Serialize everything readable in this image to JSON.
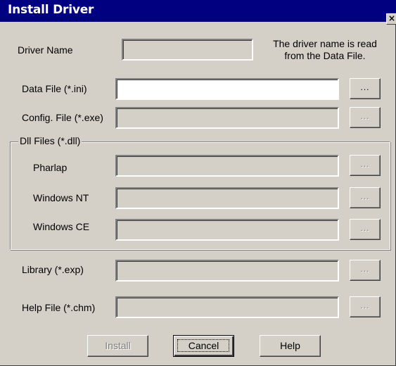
{
  "window": {
    "title": "Install Driver",
    "close_glyph": "×"
  },
  "driver_name": {
    "label": "Driver Name",
    "value": "",
    "note_line1": "The driver name is read",
    "note_line2": "from the Data File."
  },
  "data_file": {
    "label": "Data File (*.ini)",
    "value": "",
    "browse_label": "..."
  },
  "config_file": {
    "label": "Config. File (*.exe)",
    "value": "",
    "browse_label": "..."
  },
  "dll_group": {
    "title": "Dll Files (*.dll)",
    "pharlap": {
      "label": "Pharlap",
      "value": "",
      "browse_label": "..."
    },
    "windows_nt": {
      "label": "Windows NT",
      "value": "",
      "browse_label": "..."
    },
    "windows_ce": {
      "label": "Windows CE",
      "value": "",
      "browse_label": "..."
    }
  },
  "library": {
    "label": "Library (*.exp)",
    "value": "",
    "browse_label": "..."
  },
  "help_file": {
    "label": "Help File (*.chm)",
    "value": "",
    "browse_label": "..."
  },
  "buttons": {
    "install": "Install",
    "cancel": "Cancel",
    "help": "Help"
  },
  "colors": {
    "face": "#d4d0c8",
    "titlebar": "#000080",
    "disabled_text": "#808080"
  }
}
